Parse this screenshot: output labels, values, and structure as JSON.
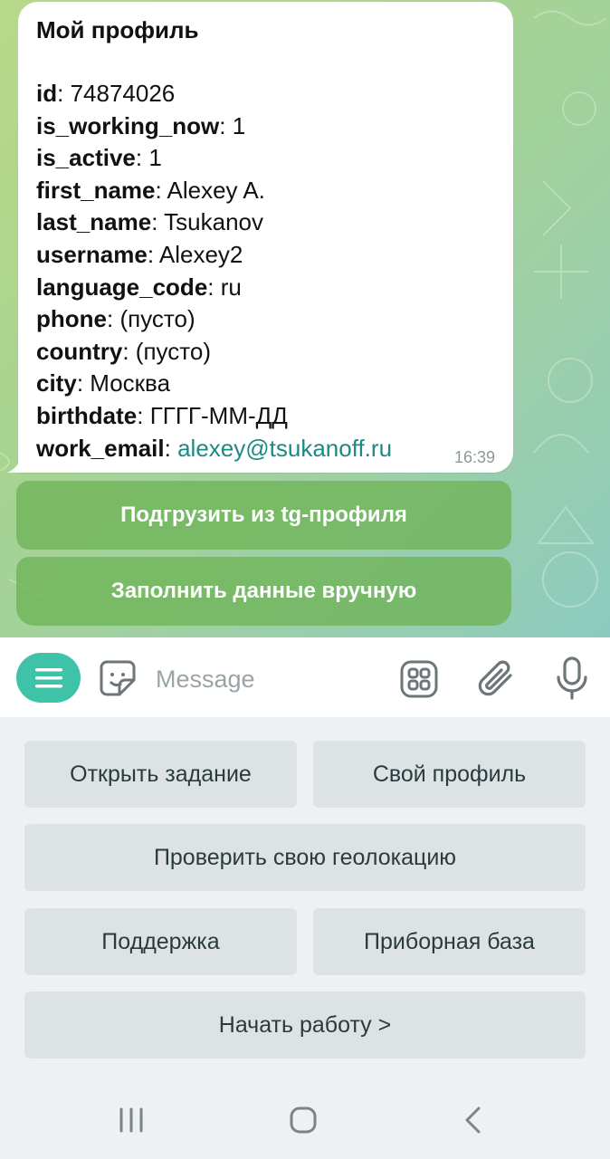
{
  "message": {
    "title": "Мой профиль",
    "fields": [
      {
        "key": "id",
        "value": "74874026"
      },
      {
        "key": "is_working_now",
        "value": "1"
      },
      {
        "key": "is_active",
        "value": "1"
      },
      {
        "key": "first_name",
        "value": "Alexey A."
      },
      {
        "key": "last_name",
        "value": "Tsukanov"
      },
      {
        "key": "username",
        "value": "Alexey2"
      },
      {
        "key": "language_code",
        "value": "ru"
      },
      {
        "key": "phone",
        "value": "(пусто)"
      },
      {
        "key": "country",
        "value": "(пусто)"
      },
      {
        "key": "city",
        "value": "Москва"
      },
      {
        "key": "birthdate",
        "value": "ГГГГ-ММ-ДД"
      },
      {
        "key": "work_email",
        "value": "alexey@tsukanoff.ru"
      }
    ],
    "time": "16:39"
  },
  "inline_buttons": {
    "load_from_tg": "Подгрузить из tg-профиля",
    "fill_manually": "Заполнить данные вручную"
  },
  "input": {
    "placeholder": "Message",
    "value": ""
  },
  "keyboard": {
    "open_task": "Открыть задание",
    "my_profile": "Свой профиль",
    "check_geo": "Проверить свою геолокацию",
    "support": "Поддержка",
    "device_base": "Приборная база",
    "start_work": "Начать работу >"
  },
  "colors": {
    "accent": "#3ec3a8",
    "link": "#1b8a84",
    "inline_button": "#70b45a",
    "keyboard_button": "#dde3e4"
  },
  "icons": [
    "menu-icon",
    "sticker-icon",
    "bot-commands-icon",
    "attach-icon",
    "mic-icon",
    "nav-recents-icon",
    "nav-home-icon",
    "nav-back-icon"
  ]
}
